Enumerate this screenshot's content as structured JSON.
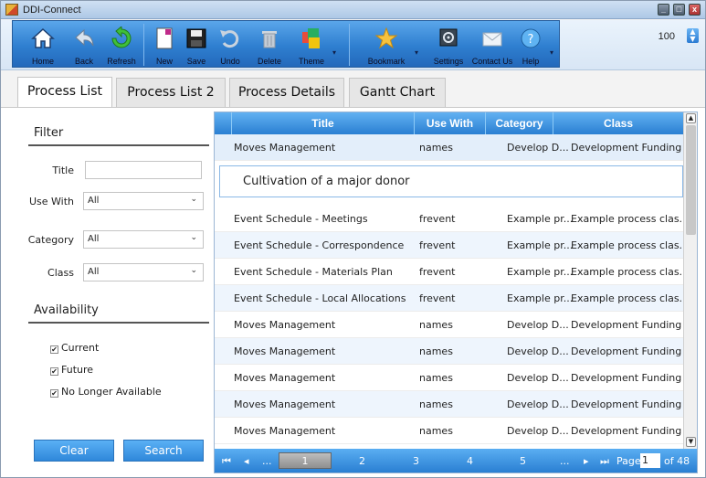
{
  "window": {
    "title": "DDI-Connect",
    "controls": [
      "_",
      "□",
      "x"
    ]
  },
  "toolbar": {
    "buttons": [
      {
        "label": "Home",
        "icon": "home-icon"
      },
      {
        "label": "Back",
        "icon": "back-arrow-icon"
      },
      {
        "label": "Refresh",
        "icon": "refresh-icon"
      },
      {
        "label": "New",
        "icon": "new-document-icon"
      },
      {
        "label": "Save",
        "icon": "save-disk-icon"
      },
      {
        "label": "Undo",
        "icon": "undo-icon"
      },
      {
        "label": "Delete",
        "icon": "trash-icon"
      },
      {
        "label": "Theme",
        "icon": "theme-icon"
      },
      {
        "label": "Bookmark",
        "icon": "star-icon"
      },
      {
        "label": "Settings",
        "icon": "settings-icon"
      },
      {
        "label": "Contact Us",
        "icon": "envelope-icon"
      },
      {
        "label": "Help",
        "icon": "help-icon"
      }
    ],
    "zoom_value": "100",
    "dropdown_glyph": "▾"
  },
  "tabs": [
    {
      "label": "Process List",
      "active": true
    },
    {
      "label": "Process List 2",
      "active": false
    },
    {
      "label": "Process Details",
      "active": false
    },
    {
      "label": "Gantt Chart",
      "active": false
    }
  ],
  "filter": {
    "heading": "Filter",
    "title_label": "Title",
    "title_value": "",
    "use_with_label": "Use With",
    "use_with_value": "All",
    "category_label": "Category",
    "category_value": "All",
    "class_label": "Class",
    "class_value": "All",
    "availability_heading": "Availability",
    "checks": [
      {
        "label": "Current",
        "checked": true
      },
      {
        "label": "Future",
        "checked": true
      },
      {
        "label": "No Longer Available",
        "checked": true
      }
    ],
    "check_mark": "✔",
    "clear_label": "Clear",
    "search_label": "Search"
  },
  "grid": {
    "columns": [
      "Title",
      "Use With",
      "Category",
      "Class"
    ],
    "first_row": {
      "title": "Moves Management",
      "use_with": "names",
      "category": "Develop D...",
      "class": "Development Funding"
    },
    "detail_text": "Cultivation of a major donor",
    "rows": [
      {
        "title": "Event Schedule - Meetings",
        "use_with": "frevent",
        "category": "Example pr...",
        "class": "Example process clas..."
      },
      {
        "title": "Event Schedule - Correspondence",
        "use_with": "frevent",
        "category": "Example pr...",
        "class": "Example process clas..."
      },
      {
        "title": "Event Schedule - Materials Plan",
        "use_with": "frevent",
        "category": "Example pr...",
        "class": "Example process clas..."
      },
      {
        "title": "Event Schedule - Local Allocations",
        "use_with": "frevent",
        "category": "Example pr...",
        "class": "Example process clas..."
      },
      {
        "title": "Moves Management",
        "use_with": "names",
        "category": "Develop D...",
        "class": "Development Funding"
      },
      {
        "title": "Moves Management",
        "use_with": "names",
        "category": "Develop D...",
        "class": "Development Funding"
      },
      {
        "title": "Moves Management",
        "use_with": "names",
        "category": "Develop D...",
        "class": "Development Funding"
      },
      {
        "title": "Moves Management",
        "use_with": "names",
        "category": "Develop D...",
        "class": "Development Funding"
      },
      {
        "title": "Moves Management",
        "use_with": "names",
        "category": "Develop D...",
        "class": "Development Funding"
      }
    ],
    "pager": {
      "first": "⏮",
      "prev": "◂",
      "ellipsis_left": "...",
      "pages": [
        "1",
        "2",
        "3",
        "4",
        "5"
      ],
      "ellipsis_right": "...",
      "next": "▸",
      "last": "⏭",
      "page_label": "Page",
      "page_value": "1",
      "of_label": "of 48"
    }
  },
  "colors": {
    "accent": "#2f88da",
    "header_blue": "#2a7fd2",
    "selected_row": "#e3eefa"
  }
}
